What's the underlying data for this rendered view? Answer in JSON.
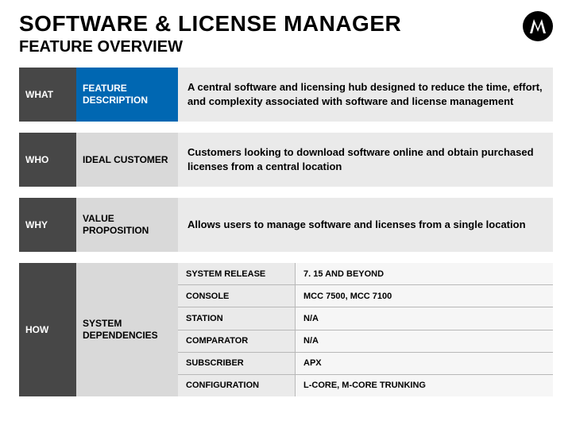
{
  "header": {
    "title": "SOFTWARE & LICENSE MANAGER",
    "subtitle": "FEATURE OVERVIEW"
  },
  "rows": {
    "what": {
      "tag": "WHAT",
      "label": "FEATURE DESCRIPTION",
      "body": "A central software and licensing hub designed to reduce the time, effort, and complexity associated with software and license management"
    },
    "who": {
      "tag": "WHO",
      "label": "IDEAL CUSTOMER",
      "body": "Customers looking to download software online and obtain purchased licenses from a central location"
    },
    "why": {
      "tag": "WHY",
      "label": "VALUE PROPOSITION",
      "body": "Allows users to manage software and licenses from a single location"
    },
    "how": {
      "tag": "HOW",
      "label": "SYSTEM DEPENDENCIES",
      "deps": [
        {
          "key": "SYSTEM RELEASE",
          "val": "7. 15 AND BEYOND"
        },
        {
          "key": "CONSOLE",
          "val": "MCC 7500, MCC 7100"
        },
        {
          "key": "STATION",
          "val": "N/A"
        },
        {
          "key": "COMPARATOR",
          "val": "N/A"
        },
        {
          "key": "SUBSCRIBER",
          "val": "APX"
        },
        {
          "key": "CONFIGURATION",
          "val": "L-CORE, M-CORE TRUNKING"
        }
      ]
    }
  }
}
